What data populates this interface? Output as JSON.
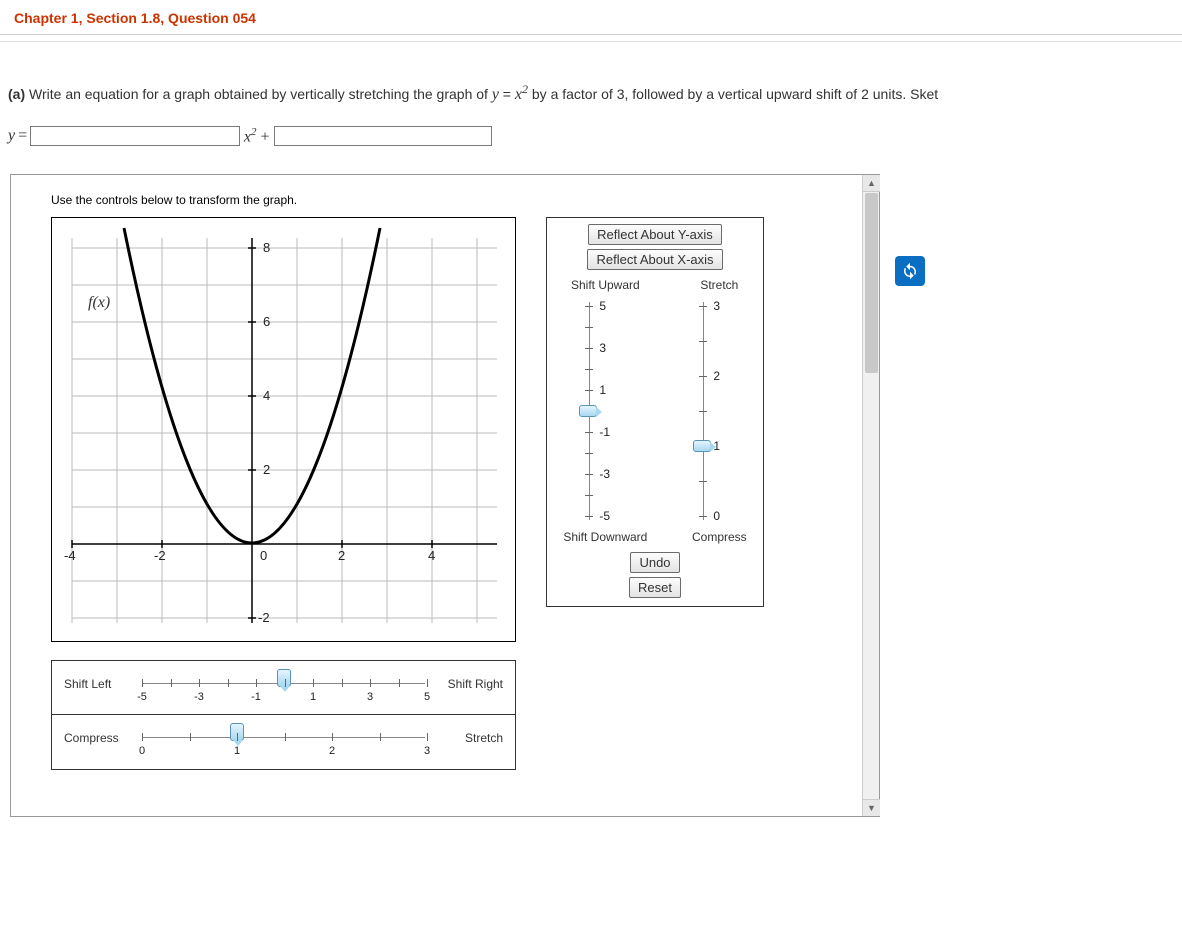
{
  "header": {
    "title": "Chapter 1, Section 1.8, Question 054"
  },
  "question": {
    "part_label": "(a)",
    "prefix": " Write an equation for a graph obtained by vertically stretching the graph of ",
    "base_func_lhs": "y",
    "base_func_eq": " = ",
    "base_func_rhs": "x",
    "base_func_exp": "2",
    "mid": " by a factor of ",
    "factor": "3",
    "mid2": ", followed by a vertical upward shift of ",
    "shift": "2",
    "suffix": " units. Sket"
  },
  "answer_row": {
    "lhs": "y",
    "eq": " = ",
    "coeff_value": "",
    "middle_var": "x",
    "middle_exp": "2",
    "plus": " + ",
    "const_value": ""
  },
  "panel": {
    "instruction": "Use the controls below to transform the graph.",
    "graph": {
      "fx_label": "f(x)",
      "y_ticks": [
        "8",
        "6",
        "4",
        "2",
        "0",
        "-2"
      ],
      "x_ticks": [
        "-4",
        "-2",
        "2",
        "4"
      ]
    },
    "controls": {
      "reflect_y": "Reflect About Y-axis",
      "reflect_x": "Reflect About X-axis",
      "shift_up_label": "Shift Upward",
      "shift_down_label": "Shift Downward",
      "stretch_label": "Stretch",
      "compress_label": "Compress",
      "shift_slider": {
        "ticks": [
          "5",
          "3",
          "1",
          "-1",
          "-3",
          "-5"
        ],
        "value": 0
      },
      "stretch_slider": {
        "ticks": [
          "3",
          "2",
          "1",
          "0"
        ],
        "value": 1
      },
      "undo": "Undo",
      "reset": "Reset"
    },
    "hslider1": {
      "left": "Shift Left",
      "right": "Shift Right",
      "ticks": [
        "-5",
        "-3",
        "-1",
        "1",
        "3",
        "5"
      ],
      "value": 0
    },
    "hslider2": {
      "left": "Compress",
      "right": "Stretch",
      "ticks": [
        "0",
        "1",
        "2",
        "3"
      ],
      "value": 1
    }
  },
  "chart_data": {
    "type": "line",
    "title": "",
    "xlabel": "",
    "ylabel": "f(x)",
    "xlim": [
      -5,
      5
    ],
    "ylim": [
      -2.5,
      8.5
    ],
    "series": [
      {
        "name": "y = x^2",
        "x": [
          -3,
          -2.5,
          -2,
          -1.5,
          -1,
          -0.5,
          0,
          0.5,
          1,
          1.5,
          2,
          2.5,
          3
        ],
        "y": [
          9,
          6.25,
          4,
          2.25,
          1,
          0.25,
          0,
          0.25,
          1,
          2.25,
          4,
          6.25,
          9
        ]
      }
    ]
  }
}
